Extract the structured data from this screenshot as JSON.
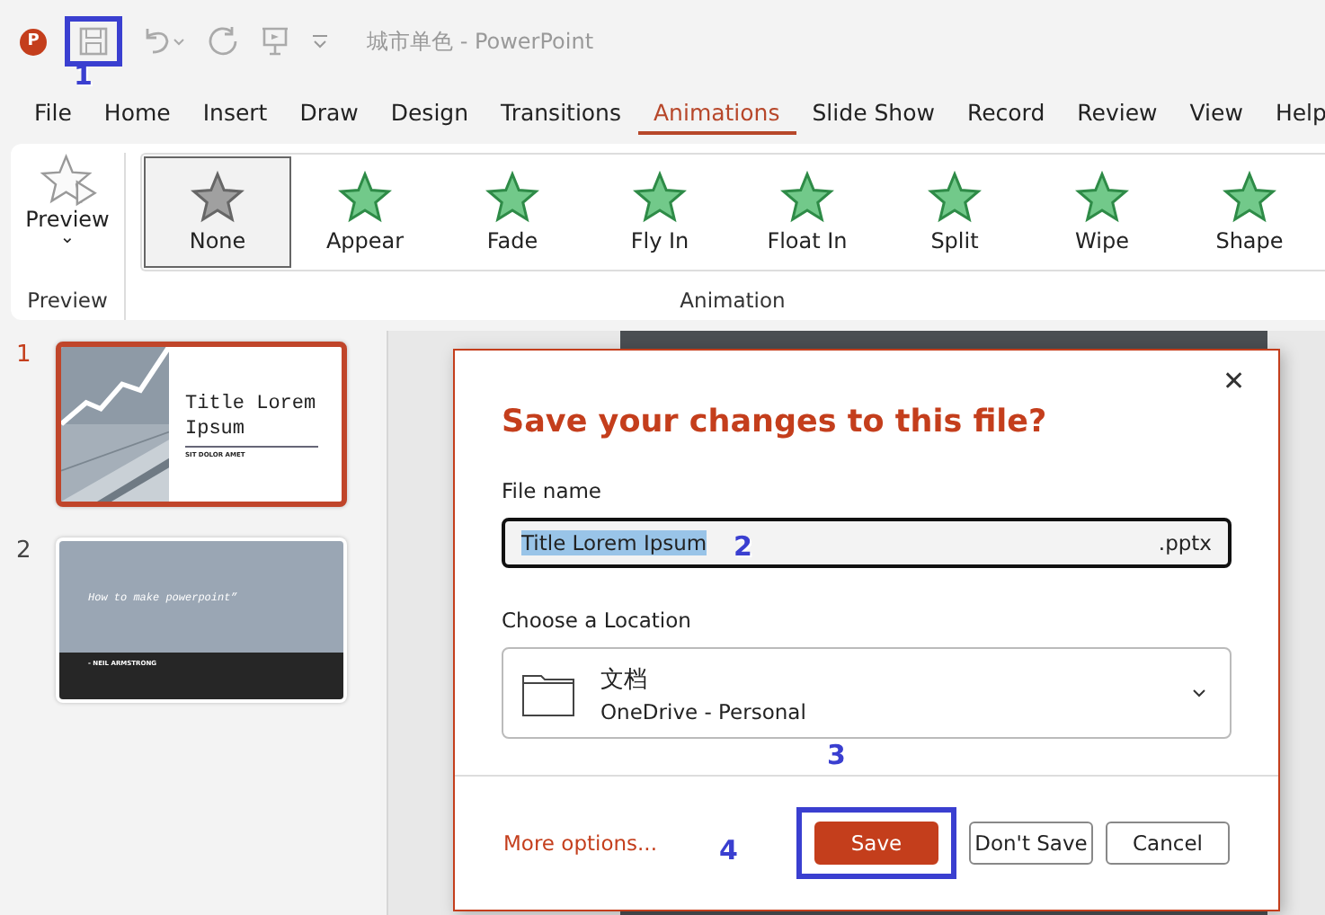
{
  "title_bar": {
    "logo_letter": "P",
    "title": "城市单色  -  PowerPoint"
  },
  "tabs": [
    {
      "label": "File",
      "selected": false
    },
    {
      "label": "Home",
      "selected": false
    },
    {
      "label": "Insert",
      "selected": false
    },
    {
      "label": "Draw",
      "selected": false
    },
    {
      "label": "Design",
      "selected": false
    },
    {
      "label": "Transitions",
      "selected": false
    },
    {
      "label": "Animations",
      "selected": true
    },
    {
      "label": "Slide Show",
      "selected": false
    },
    {
      "label": "Record",
      "selected": false
    },
    {
      "label": "Review",
      "selected": false
    },
    {
      "label": "View",
      "selected": false
    },
    {
      "label": "Help",
      "selected": false
    }
  ],
  "ribbon": {
    "preview": {
      "label": "Preview",
      "caret": "⌄",
      "group": "Preview"
    },
    "animations": [
      {
        "label": "None",
        "kind": "none",
        "selected": true
      },
      {
        "label": "Appear",
        "kind": "effect",
        "selected": false
      },
      {
        "label": "Fade",
        "kind": "effect",
        "selected": false
      },
      {
        "label": "Fly In",
        "kind": "effect",
        "selected": false
      },
      {
        "label": "Float In",
        "kind": "effect",
        "selected": false
      },
      {
        "label": "Split",
        "kind": "effect",
        "selected": false
      },
      {
        "label": "Wipe",
        "kind": "effect",
        "selected": false
      },
      {
        "label": "Shape",
        "kind": "effect",
        "selected": false
      }
    ],
    "group": "Animation"
  },
  "slides": [
    {
      "number": "1",
      "selected": true,
      "kind": "title",
      "title": "Title Lorem Ipsum",
      "subtitle": "SIT DOLOR AMET"
    },
    {
      "number": "2",
      "selected": false,
      "kind": "quote",
      "title": "How to make powerpoint”",
      "subtitle": "- NEIL ARMSTRONG"
    }
  ],
  "dialog": {
    "close": "✕",
    "heading": "Save your changes to this file?",
    "file_label": "File name",
    "file_value": "Title Lorem Ipsum",
    "extension": ".pptx",
    "location_label": "Choose a Location",
    "location_name": "文档",
    "location_sub": "OneDrive - Personal",
    "more": "More options...",
    "buttons": [
      {
        "label": "Save",
        "kind": "primary"
      },
      {
        "label": "Don't Save",
        "kind": "secondary"
      },
      {
        "label": "Cancel",
        "kind": "secondary"
      }
    ]
  },
  "callouts": [
    "1",
    "2",
    "3",
    "4"
  ]
}
